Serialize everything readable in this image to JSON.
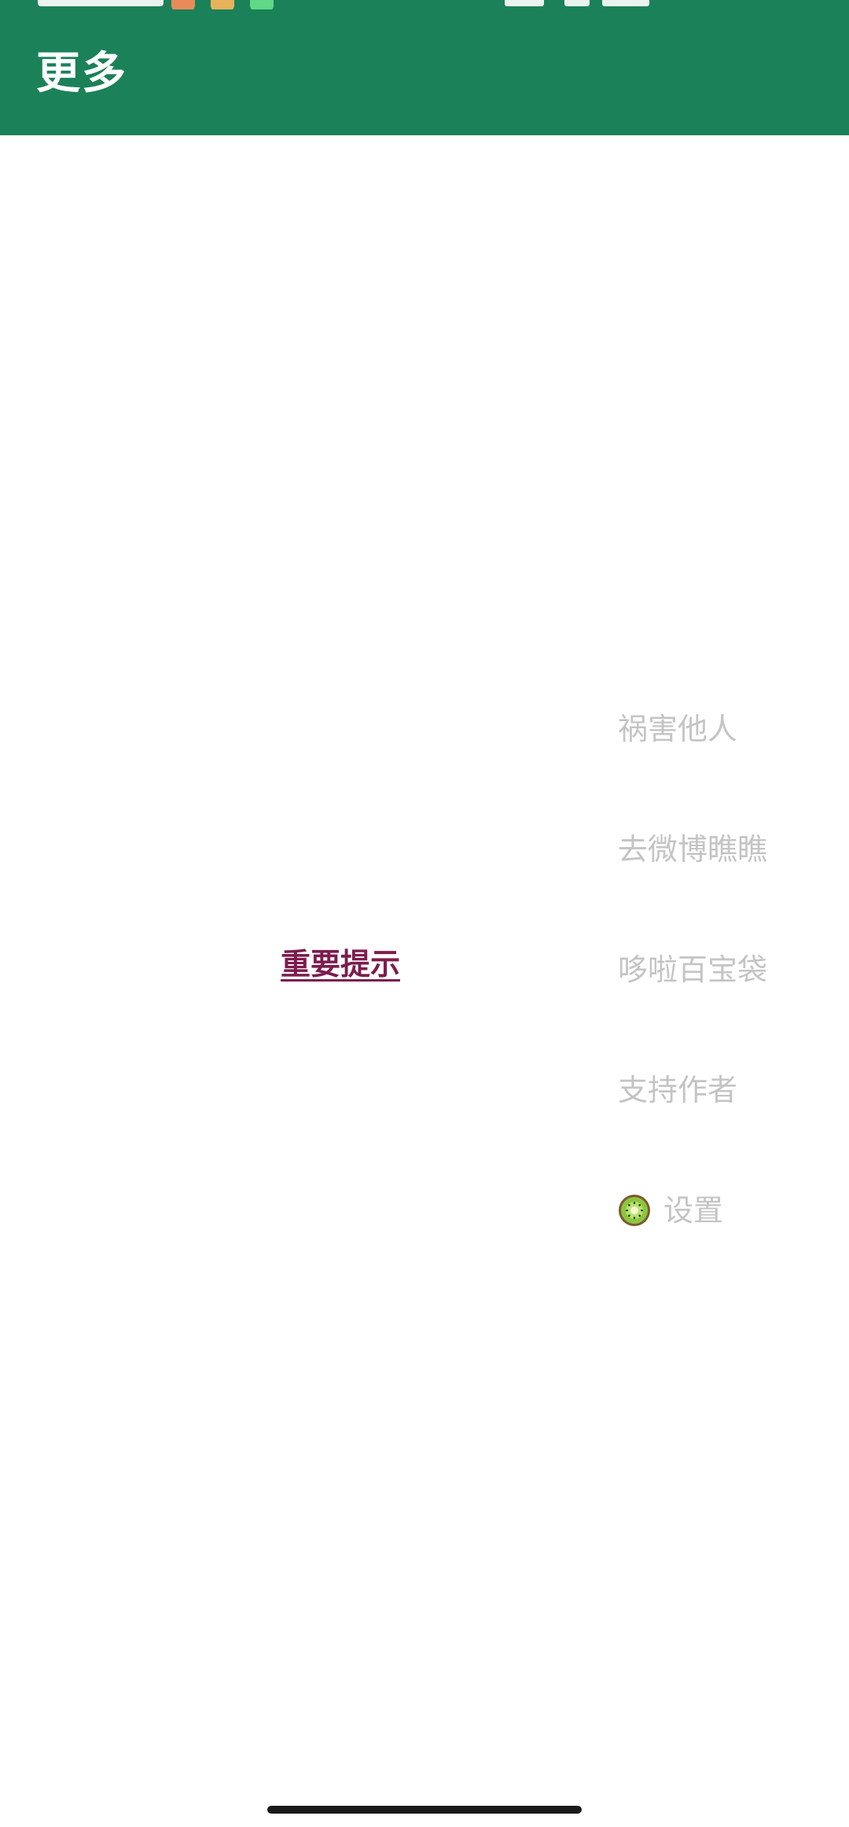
{
  "app_bar": {
    "title": "更多",
    "color": "#1b8158"
  },
  "main": {
    "notice_link": "重要提示",
    "notice_color": "#7c1d4e"
  },
  "menu": {
    "items": [
      {
        "label": "祸害他人"
      },
      {
        "label": "去微博瞧瞧"
      },
      {
        "label": "哆啦百宝袋"
      },
      {
        "label": "支持作者"
      },
      {
        "label": "设置",
        "icon": "kiwi-icon"
      }
    ],
    "text_color": "#c4c4c4"
  }
}
